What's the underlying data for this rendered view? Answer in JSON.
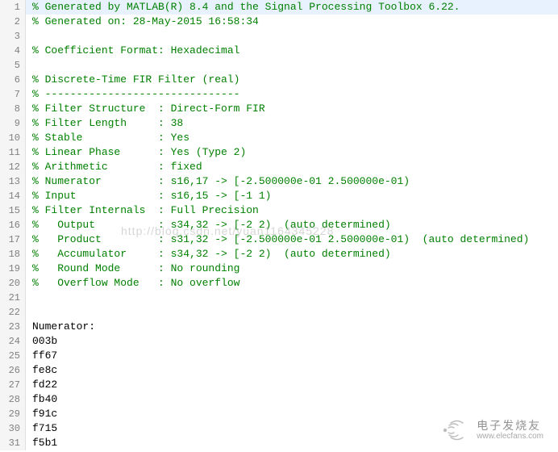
{
  "lines": [
    {
      "n": 1,
      "comment": true,
      "text": "% Generated by MATLAB(R) 8.4 and the Signal Processing Toolbox 6.22.",
      "current": true
    },
    {
      "n": 2,
      "comment": true,
      "text": "% Generated on: 28-May-2015 16:58:34"
    },
    {
      "n": 3,
      "comment": false,
      "text": ""
    },
    {
      "n": 4,
      "comment": true,
      "text": "% Coefficient Format: Hexadecimal"
    },
    {
      "n": 5,
      "comment": false,
      "text": ""
    },
    {
      "n": 6,
      "comment": true,
      "text": "% Discrete-Time FIR Filter (real)"
    },
    {
      "n": 7,
      "comment": true,
      "text": "% -------------------------------"
    },
    {
      "n": 8,
      "comment": true,
      "text": "% Filter Structure  : Direct-Form FIR"
    },
    {
      "n": 9,
      "comment": true,
      "text": "% Filter Length     : 38"
    },
    {
      "n": 10,
      "comment": true,
      "text": "% Stable            : Yes"
    },
    {
      "n": 11,
      "comment": true,
      "text": "% Linear Phase      : Yes (Type 2)"
    },
    {
      "n": 12,
      "comment": true,
      "text": "% Arithmetic        : fixed"
    },
    {
      "n": 13,
      "comment": true,
      "text": "% Numerator         : s16,17 -> [-2.500000e-01 2.500000e-01)"
    },
    {
      "n": 14,
      "comment": true,
      "text": "% Input             : s16,15 -> [-1 1)"
    },
    {
      "n": 15,
      "comment": true,
      "text": "% Filter Internals  : Full Precision"
    },
    {
      "n": 16,
      "comment": true,
      "text": "%   Output          : s34,32 -> [-2 2)  (auto determined)"
    },
    {
      "n": 17,
      "comment": true,
      "text": "%   Product         : s31,32 -> [-2.500000e-01 2.500000e-01)  (auto determined)"
    },
    {
      "n": 18,
      "comment": true,
      "text": "%   Accumulator     : s34,32 -> [-2 2)  (auto determined)"
    },
    {
      "n": 19,
      "comment": true,
      "text": "%   Round Mode      : No rounding"
    },
    {
      "n": 20,
      "comment": true,
      "text": "%   Overflow Mode   : No overflow"
    },
    {
      "n": 21,
      "comment": false,
      "text": ""
    },
    {
      "n": 22,
      "comment": false,
      "text": ""
    },
    {
      "n": 23,
      "comment": false,
      "text": "Numerator:"
    },
    {
      "n": 24,
      "comment": false,
      "text": "003b"
    },
    {
      "n": 25,
      "comment": false,
      "text": "ff67"
    },
    {
      "n": 26,
      "comment": false,
      "text": "fe8c"
    },
    {
      "n": 27,
      "comment": false,
      "text": "fd22"
    },
    {
      "n": 28,
      "comment": false,
      "text": "fb40"
    },
    {
      "n": 29,
      "comment": false,
      "text": "f91c"
    },
    {
      "n": 30,
      "comment": false,
      "text": "f715"
    },
    {
      "n": 31,
      "comment": false,
      "text": "f5b1"
    }
  ],
  "watermark": "http://blog.csdn.net/yuan1164345228",
  "footer": {
    "brand_cn": "电子发烧友",
    "brand_en": "www.elecfans.com"
  }
}
